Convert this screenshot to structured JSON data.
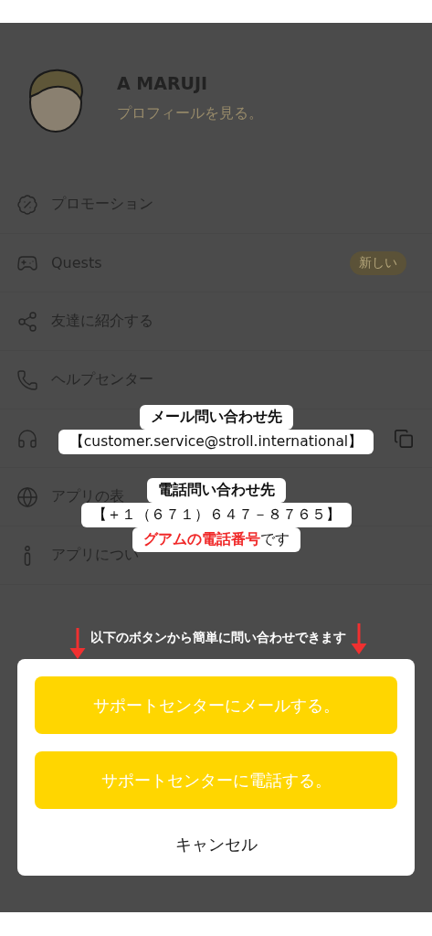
{
  "profile": {
    "name": "A MARUJI",
    "link": "プロフィールを見る。"
  },
  "menu": [
    {
      "kind": "link",
      "label": "プロモーション"
    },
    {
      "kind": "link",
      "label": "Quests",
      "badge": "新しい"
    },
    {
      "kind": "link",
      "label": "友達に紹介する"
    },
    {
      "kind": "link",
      "label": "ヘルプセンター"
    },
    {
      "kind": "copyable"
    },
    {
      "kind": "link",
      "label": "アプリの表"
    },
    {
      "kind": "link",
      "label": "アプリについ"
    }
  ],
  "callouts": [
    {
      "title": "メール問い合わせ先",
      "value": "【customer.service@stroll.international】"
    },
    {
      "title": "電話問い合わせ先",
      "value": "【＋１（６７１）６４７－８７６５】",
      "note": "**グアムの電話番号**です"
    }
  ],
  "hint": "以下のボタンから簡単に問い合わせできます",
  "sheet": [
    {
      "kind": "primary",
      "label": "サポートセンターにメールする。"
    },
    {
      "kind": "primary",
      "label": "サポートセンターに電話する。"
    },
    {
      "kind": "plain",
      "label": "キャンセル"
    }
  ]
}
